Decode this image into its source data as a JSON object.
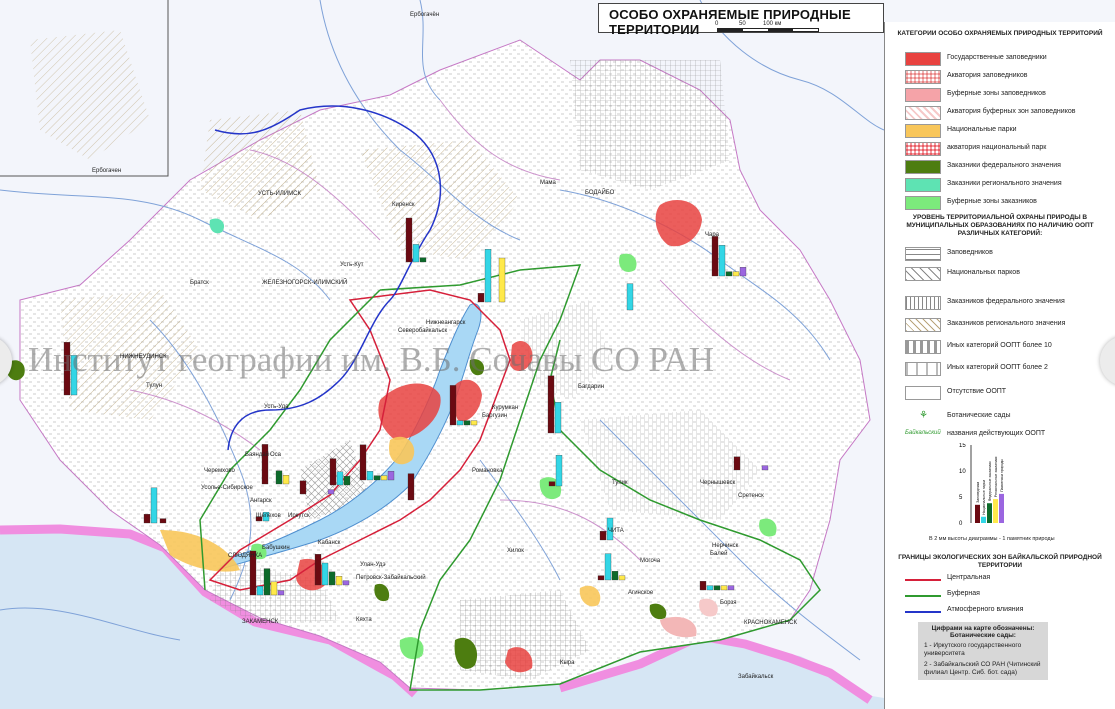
{
  "title": "ОСОБО ОХРАНЯЕМЫЕ ПРИРОДНЫЕ ТЕРРИТОРИИ",
  "scale": {
    "ticks": [
      "0",
      "50",
      "100 км"
    ]
  },
  "watermark": "Институт географии им. В.Б. Сочавы СО РАН",
  "legend": {
    "categories_header": "КАТЕГОРИИ ОСОБО ОХРАНЯЕМЫХ ПРИРОДНЫХ ТЕРРИТОРИЙ",
    "categories": [
      {
        "label": "Государственные заповедники",
        "color": "#e8423f",
        "pattern": "solid"
      },
      {
        "label": "Акватория заповедников",
        "color": "#f3b7b7",
        "pattern": "grid"
      },
      {
        "label": "Буферные зоны заповедников",
        "color": "#f5a3a8",
        "pattern": "solid"
      },
      {
        "label": "Акватория буферных зон заповедников",
        "color": "#f6c9c9",
        "pattern": "hatch"
      },
      {
        "label": "Национальные парки",
        "color": "#f8c65a",
        "pattern": "solid"
      },
      {
        "label": "акватория национальный парк",
        "color": "#f39aa0",
        "pattern": "grid"
      },
      {
        "label": "Заказники федерального значения",
        "color": "#4d7d10",
        "pattern": "solid"
      },
      {
        "label": "Заказники регионального значения",
        "color": "#5ee3b3",
        "pattern": "solid"
      },
      {
        "label": "Буферные зоны заказников",
        "color": "#7cea7c",
        "pattern": "solid"
      }
    ],
    "levels_header": "УРОВЕНЬ ТЕРРИТОРИАЛЬНОЙ ОХРАНЫ ПРИРОДЫ В МУНИЦИПАЛЬНЫХ ОБРАЗОВАНИЯХ ПО НАЛИЧИЮ ООПТ РАЗЛИЧНЫХ КАТЕГОРИЙ:",
    "levels": [
      {
        "label": "Заповедников",
        "pattern": "grid"
      },
      {
        "label": "Национальных парков",
        "pattern": "cross"
      },
      {
        "label": "Заказников федерального значения",
        "pattern": "vertical"
      },
      {
        "label": "Заказников регионального значения",
        "pattern": "diagonal"
      },
      {
        "label": "Иных категорий ООПТ более 10",
        "pattern": "dashes"
      },
      {
        "label": "Иных категорий ООПТ более 2",
        "pattern": "sparse"
      },
      {
        "label": "Отсутствие ООПТ",
        "pattern": "none"
      }
    ],
    "botanic_label": "Ботанические сады",
    "names_sample": "Байкальский",
    "names_label": "названия действующих ООПТ",
    "mini_chart": {
      "ticks": [
        "0",
        "5",
        "10",
        "15"
      ],
      "bars": [
        {
          "name": "Заповедники",
          "value": 3.5,
          "color": "#6b0a12"
        },
        {
          "name": "Национальные парки",
          "value": 1.2,
          "color": "#33d6e6"
        },
        {
          "name": "Федеральные заказники",
          "value": 3.8,
          "color": "#0d6a2a"
        },
        {
          "name": "Региональные заказники",
          "value": 4.6,
          "color": "#ffe94a"
        },
        {
          "name": "Памятники природы",
          "value": 5.6,
          "color": "#9b66e0"
        }
      ],
      "note": "В 2 мм высоты диаграммы - 1 памятник природы"
    },
    "zones_header": "ГРАНИЦЫ ЭКОЛОГИЧЕСКИХ ЗОН БАЙКАЛЬСКОЙ ПРИРОДНОЙ ТЕРРИТОРИИ",
    "zones": [
      {
        "label": "Центральная",
        "color": "#d6203a"
      },
      {
        "label": "Буферная",
        "color": "#2f9a2f"
      },
      {
        "label": "Атмосферного влияния",
        "color": "#2435c9"
      }
    ],
    "note_box": {
      "title": "Цифрами на карте обозначены: Ботанические сады:",
      "items": [
        "1 - Иркутского государственного университета",
        "2 - Забайкальский СО РАН (Читинский филиал Центр. Сиб. бот. сада)"
      ]
    }
  },
  "places": [
    "Ербогачён",
    "Ербогачен",
    "Мама",
    "БОДАЙБО",
    "Чара",
    "Братск",
    "Усть-Кут",
    "Киренск",
    "ЖЕЛЕЗНОГОРСК-ИЛИМСКИЙ",
    "УСТЬ-ИЛИМСК",
    "Нижнеангарск",
    "Северобайкальск",
    "Тулун",
    "НИЖНЕУДИНСК",
    "Усть-Уда",
    "Баяндай",
    "Оса",
    "Иркутск",
    "Ангарск",
    "Черемхово",
    "Усолье-Сибирское",
    "Шелехов",
    "СЛЮДЯНКА",
    "Бабушкин",
    "Кабанск",
    "Улан-Удэ",
    "ЗАКАМЕНСК",
    "Кяхта",
    "Петровск-Забайкальский",
    "ЧИТА",
    "Могоча",
    "Сретенск",
    "Чернышевск",
    "Нерчинск",
    "Балей",
    "Борзя",
    "КРАСНОКАМЕНСК",
    "Забайкальск",
    "Баргузин",
    "Курумкан",
    "Багдарин",
    "Романовка",
    "Тупик",
    "Хилок",
    "Кыра",
    "Агинское"
  ]
}
